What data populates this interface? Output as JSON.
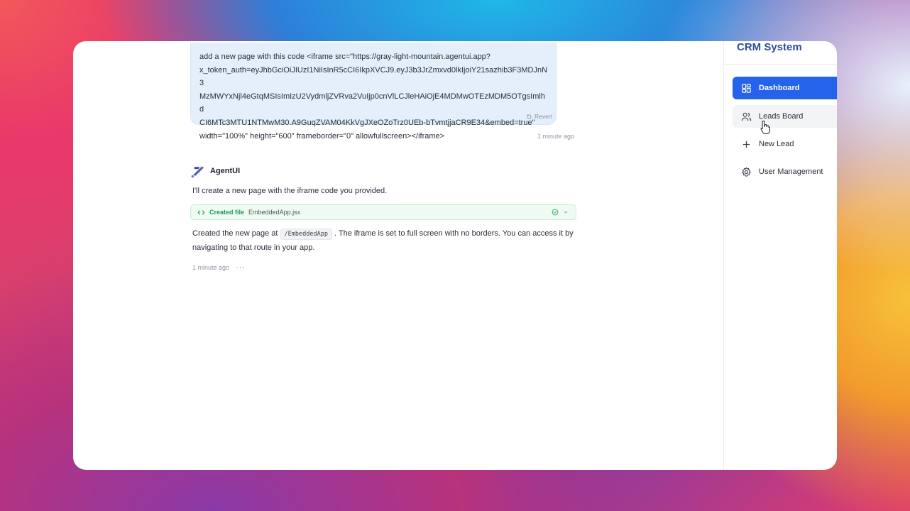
{
  "chat": {
    "user_message": "add a new page with this code <iframe src=\"https://gray-light-mountain.agentui.app?\nx_token_auth=eyJhbGciOiJIUzI1NiIsInR5cCI6IkpXVCJ9.eyJ3b3JrZmxvd0lkIjoiY21sazhib3F3MDJnN3\nMzMWYxNjl4eGtqMSIsImIzU2VydmljZVRva2VuIjp0cnVlLCJleHAiOjE4MDMwOTEzMDM5OTgsImlhd\nCI6MTc3MTU1NTMwM30.A9GuqZVAM04KkVgJXeOZoTrz0UEb-bTvmtjjaCR9E34&embed=true\"\nwidth=\"100%\" height=\"600\" frameborder=\"0\" allowfullscreen></iframe>",
    "revert_label": "Revert",
    "user_timestamp": "1 minute ago",
    "agent_name": "AgentUI",
    "agent_intro": "I'll create a new page with the iframe code you provided.",
    "file_card": {
      "status_label": "Created file",
      "file_name": "EmbeddedApp.jsx"
    },
    "agent_text_before": "Created the new page at ",
    "agent_code": "/EmbeddedApp",
    "agent_text_after": " . The iframe is set to full screen with no borders. You can access it by navigating to that route in your app.",
    "agent_timestamp": "1 minute ago",
    "more_label": "···"
  },
  "sidebar": {
    "brand": "CRM System",
    "items": [
      {
        "label": "Dashboard",
        "icon": "layout-grid-icon",
        "active": true
      },
      {
        "label": "Leads Board",
        "icon": "users-icon",
        "hovered": true
      },
      {
        "label": "New Lead",
        "icon": "plus-icon"
      },
      {
        "label": "User Management",
        "icon": "gear-icon"
      }
    ]
  },
  "colors": {
    "accent": "#2563eb",
    "brand_text": "#2d4e9e",
    "user_bubble": "#e4effb",
    "file_card_bg": "#eefbf2",
    "file_card_text": "#1f9a5a"
  }
}
